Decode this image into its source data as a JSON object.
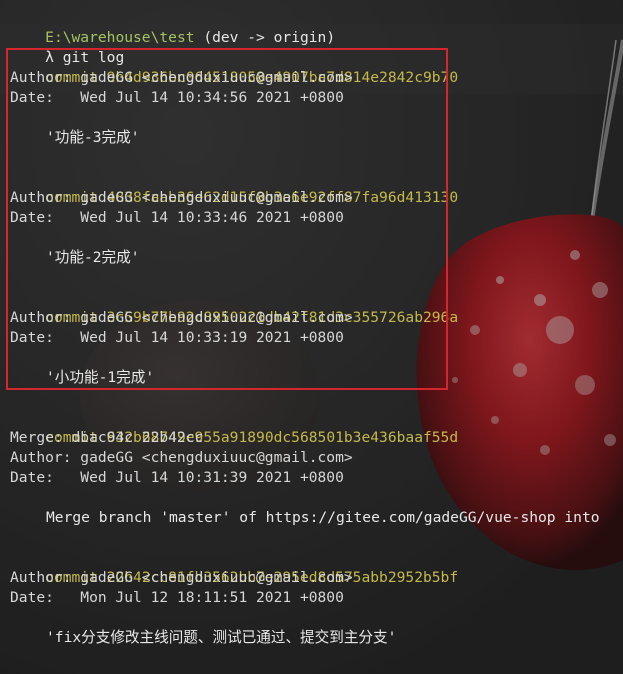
{
  "prompt": {
    "path": "E:\\warehouse\\test",
    "branch": "(dev -> origin)",
    "lambda": "λ",
    "command": "git log"
  },
  "commits": [
    {
      "keyword": "commit",
      "hash": "9b4d936bc064518058a4907ba7d814e2842c9b70",
      "merge": null,
      "author": "Author: gadeGG <chengduxiuuc@gmail.com>",
      "date": "Date:   Wed Jul 14 10:34:56 2021 +0800",
      "message": "'功能-3完成'"
    },
    {
      "keyword": "commit",
      "hash": "4838faab36e62d15f8b3e6e92ff87fa96d413130",
      "merge": null,
      "author": "Author: gadeGG <chengduxiuuc@gmail.com>",
      "date": "Date:   Wed Jul 14 10:33:46 2021 +0800",
      "message": "'功能-2完成'"
    },
    {
      "keyword": "commit",
      "hash": "3c59b77b92c8950221db42f81d3c355726ab296a",
      "merge": null,
      "author": "Author: gadeGG <chengduxiuuc@gmail.com>",
      "date": "Date:   Wed Jul 14 10:33:19 2021 +0800",
      "message": "'小功能-1完成'"
    },
    {
      "keyword": "commit",
      "hash": "632b68749e955a91890dc568501b3e436baaf55d",
      "merge": "Merge: dbac94c 22b42cc",
      "author": "Author: gadeGG <chengduxiuuc@gmail.com>",
      "date": "Date:   Wed Jul 14 10:31:39 2021 +0800",
      "message": "Merge branch 'master' of https://gitee.com/gadeGG/vue-shop into"
    },
    {
      "keyword": "commit",
      "hash": "22b42cc81fb3562bb7e295ed8d575abb2952b5bf",
      "merge": null,
      "author": "Author: gadeGG <chengduxiuuc@gmail.com>",
      "date": "Date:   Mon Jul 12 18:11:51 2021 +0800",
      "message": "'fix分支修改主线问题、测试已通过、提交到主分支'"
    }
  ],
  "colors": {
    "commit_hash": "#c5b94b",
    "prompt_path": "#a5c261",
    "highlight_box": "#d6262d",
    "background": "#262626"
  }
}
